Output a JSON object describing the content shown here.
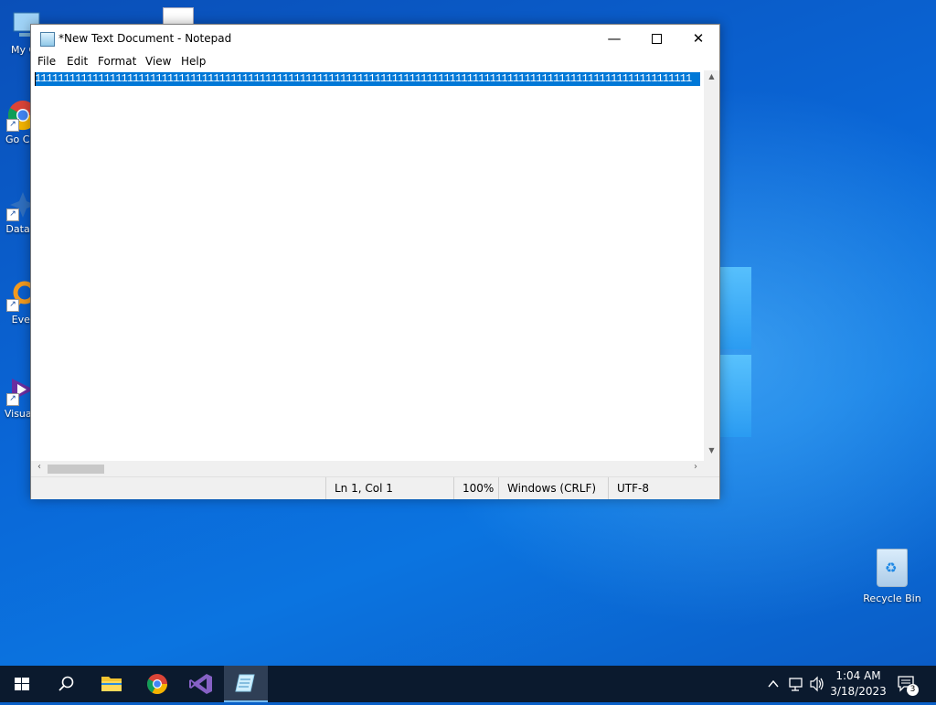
{
  "desktop": {
    "icons": [
      {
        "label": "My Co"
      },
      {
        "label": "Go Chr"
      },
      {
        "label": "DataW"
      },
      {
        "label": "Ever"
      },
      {
        "label": "Visua 2"
      }
    ],
    "recycle_bin": {
      "label": "Recycle Bin"
    }
  },
  "window": {
    "title": "*New Text Document - Notepad",
    "controls": {
      "minimize": "—",
      "close": "✕"
    },
    "menu": [
      "File",
      "Edit",
      "Format",
      "View",
      "Help"
    ],
    "content": "111111111111111111111111111111111111111111111111111111111111111111111111111111111111111111111111111111111111111111",
    "status": {
      "position": "Ln 1, Col 1",
      "zoom": "100%",
      "line_ending": "Windows (CRLF)",
      "encoding": "UTF-8"
    }
  },
  "taskbar": {
    "apps": [
      "start-icon",
      "search-icon",
      "file-explorer-icon",
      "chrome-icon",
      "visual-studio-icon",
      "notepad-icon"
    ],
    "active_app": "notepad-icon",
    "clock": {
      "time": "1:04 AM",
      "date": "3/18/2023"
    },
    "notification_count": "3"
  },
  "colors": {
    "selection": "#0078d7",
    "taskbar": "#0b1a2e",
    "desktop": "#0a66d6"
  }
}
